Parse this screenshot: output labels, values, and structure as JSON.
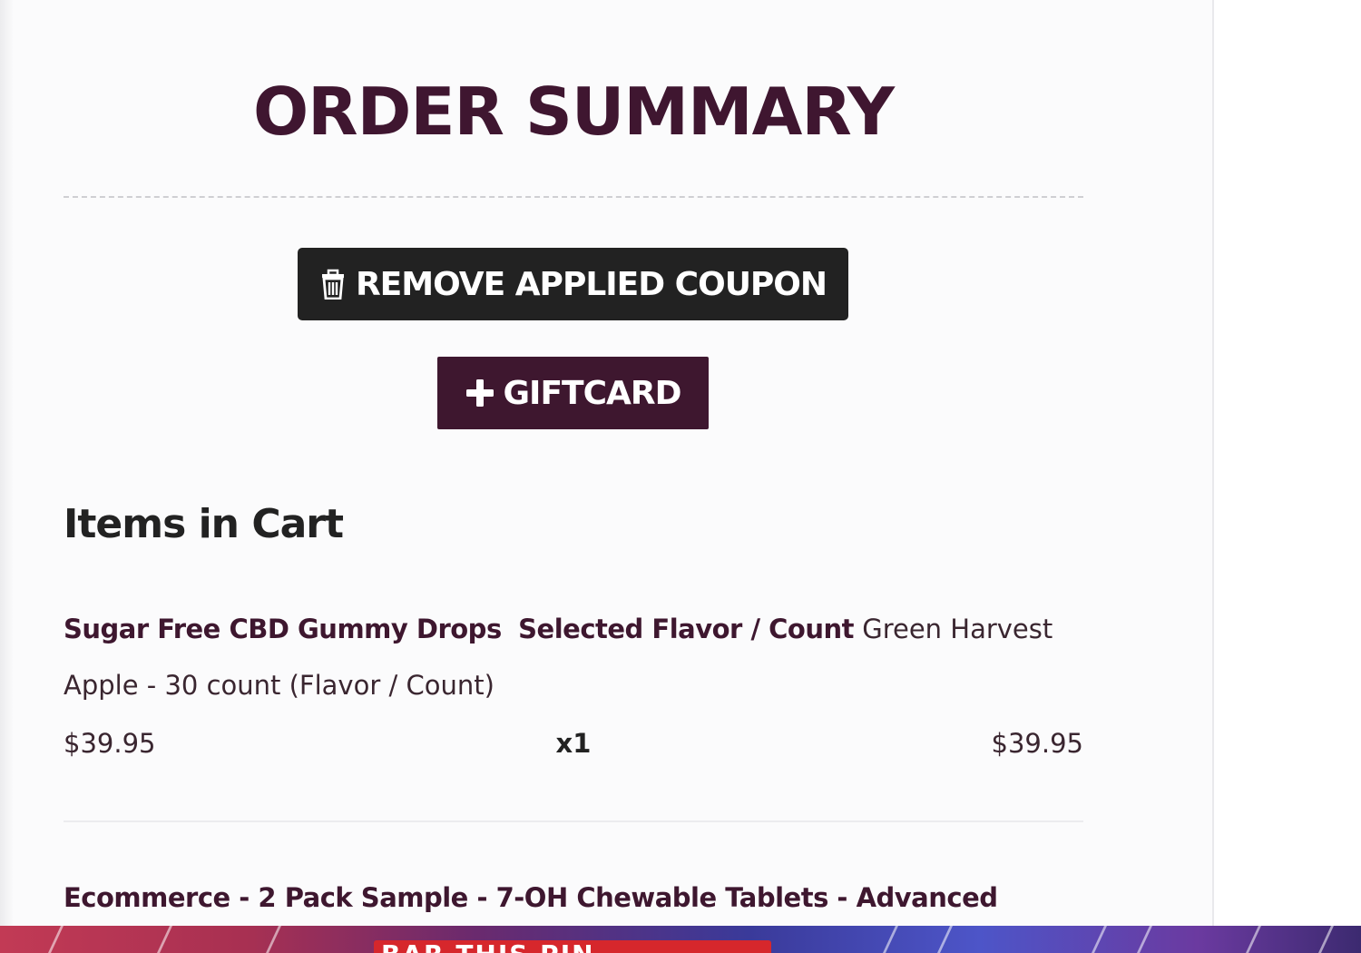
{
  "order_summary": {
    "title": "ORDER SUMMARY",
    "remove_coupon_label": "REMOVE APPLIED COUPON",
    "giftcard_label": "GIFTCARD"
  },
  "cart": {
    "heading": "Items in Cart",
    "items": [
      {
        "name": "Sugar Free CBD Gummy Drops",
        "option_label": "Selected Flavor / Count",
        "option_value": "Green Harvest Apple - 30 count (Flavor / Count)",
        "price": "$39.95",
        "quantity": "x1",
        "total": "$39.95"
      },
      {
        "name": "Ecommerce - 2 Pack Sample - 7-OH Chewable Tablets - Advanced"
      }
    ]
  },
  "banner": {
    "badge_text": "BAR THIS PIN"
  },
  "colors": {
    "brand_plum": "#3e172f",
    "dark_button": "#222222",
    "background": "#fbfbfc"
  },
  "icons": {
    "remove_coupon": "trash-icon",
    "giftcard": "plus-icon"
  }
}
